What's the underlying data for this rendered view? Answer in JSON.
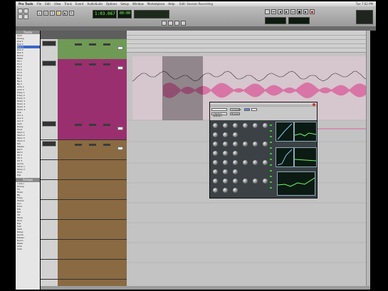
{
  "menubar": {
    "items": [
      "Pro Tools",
      "File",
      "Edit",
      "View",
      "Track",
      "Event",
      "AudioSuite",
      "Options",
      "Setup",
      "Window",
      "Marketplace",
      "Help"
    ],
    "window_title": "Edit: Session Recording",
    "clock": "Tue 7:02 PM"
  },
  "counter": {
    "main": "1:03.067",
    "sub": "00:00"
  },
  "sidebar": {
    "tracks_header": "Tracks",
    "track_names": [
      "Click",
      "Dialog",
      "Dial 1",
      "Dial 2",
      "Dial 3",
      "Dial 4",
      "Dial 5",
      "Room",
      "Walla",
      "FX 1",
      "FX 2",
      "FX 3",
      "FX 4",
      "FX 5",
      "FX 6",
      "Bg 1",
      "Bg 2",
      "Bg 3",
      "Amb 1",
      "Amb 2",
      "Foley 1",
      "Foley 2",
      "Foley 3",
      "Music 1",
      "Music 2",
      "Music 3",
      "Music 4",
      "Sub",
      "Aux 1",
      "Aux 2",
      "Aux 3",
      "Verb",
      "Delay",
      "Print",
      "Stem 1",
      "Stem 2",
      "Stem 3",
      "Stem 4",
      "Mix",
      "Master",
      "Ref 1",
      "Ref 2",
      "VO 1",
      "VO 2",
      "VO 3",
      "Guide",
      "Temp 1",
      "Temp 2",
      "Tone",
      "Pop"
    ],
    "groups_header": "Groups",
    "group_names": [
      "<ALL>",
      "Dialog",
      "FX",
      "Music",
      "Bg",
      "Foley",
      "Stems",
      "Aux",
      "Print",
      "Mix",
      "Ref",
      "VO",
      "Temp",
      "Tone",
      "Pop",
      "Sub",
      "Verb",
      "Delay",
      "Guide",
      "Master",
      "Room",
      "Walla",
      "Amb",
      "Click"
    ],
    "selected_track": "Dial 3"
  },
  "plugin": {
    "presets_label": "<factory default>",
    "compare_label": "Compare",
    "bypass_label": "Bypass"
  },
  "colors": {
    "green_track": "#6f9a55",
    "magenta_track": "#9a2f6f",
    "brown_track": "#8a6a42",
    "waveform": "#d9609c",
    "selection": "#3a66c8"
  }
}
